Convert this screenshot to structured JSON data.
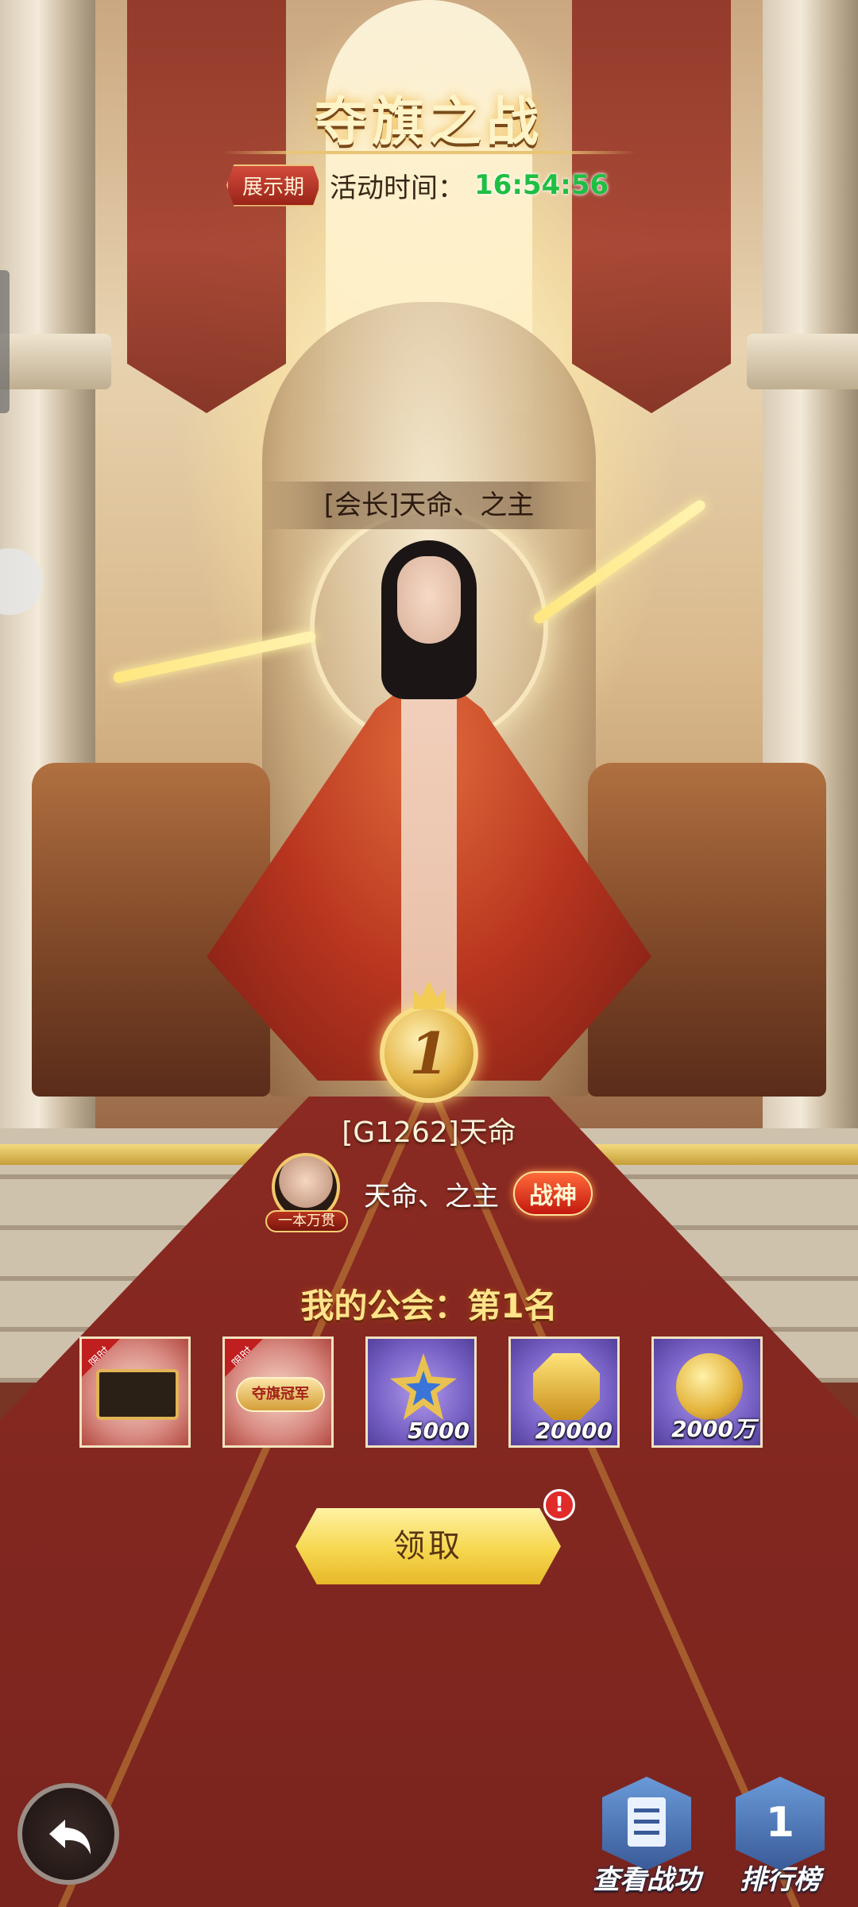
{
  "event": {
    "title": "夺旗之战",
    "phase_badge": "展示期",
    "timer_label": "活动时间：",
    "timer_value": "16:54:56"
  },
  "champion": {
    "guild_leader_plaque": "[会长]天命、之主",
    "rank_number": "1",
    "guild_id_name": "[G1262]天命",
    "leader_name": "天命、之主",
    "avatar_tag": "一本万贯",
    "title_badge": "战神"
  },
  "my_guild": {
    "rank_text": "我的公会：第1名"
  },
  "rewards": [
    {
      "icon": "limited-frame-icon",
      "tag": "限时",
      "qty": ""
    },
    {
      "icon": "limited-title-icon",
      "tag": "限时",
      "chip": "夺旗冠军",
      "qty": ""
    },
    {
      "icon": "star-medal-icon",
      "qty": "5000"
    },
    {
      "icon": "gold-crest-icon",
      "qty": "20000"
    },
    {
      "icon": "gold-coin-icon",
      "qty": "2000万"
    }
  ],
  "actions": {
    "claim_label": "领取",
    "alert": "!",
    "view_merit_label": "查看战功",
    "leaderboard_label": "排行榜",
    "leaderboard_icon_text": "1"
  },
  "colors": {
    "timer_green": "#1fbf43",
    "badge_red": "#c3180e",
    "gold": "#f6d74e",
    "carpet": "#7a241e"
  }
}
